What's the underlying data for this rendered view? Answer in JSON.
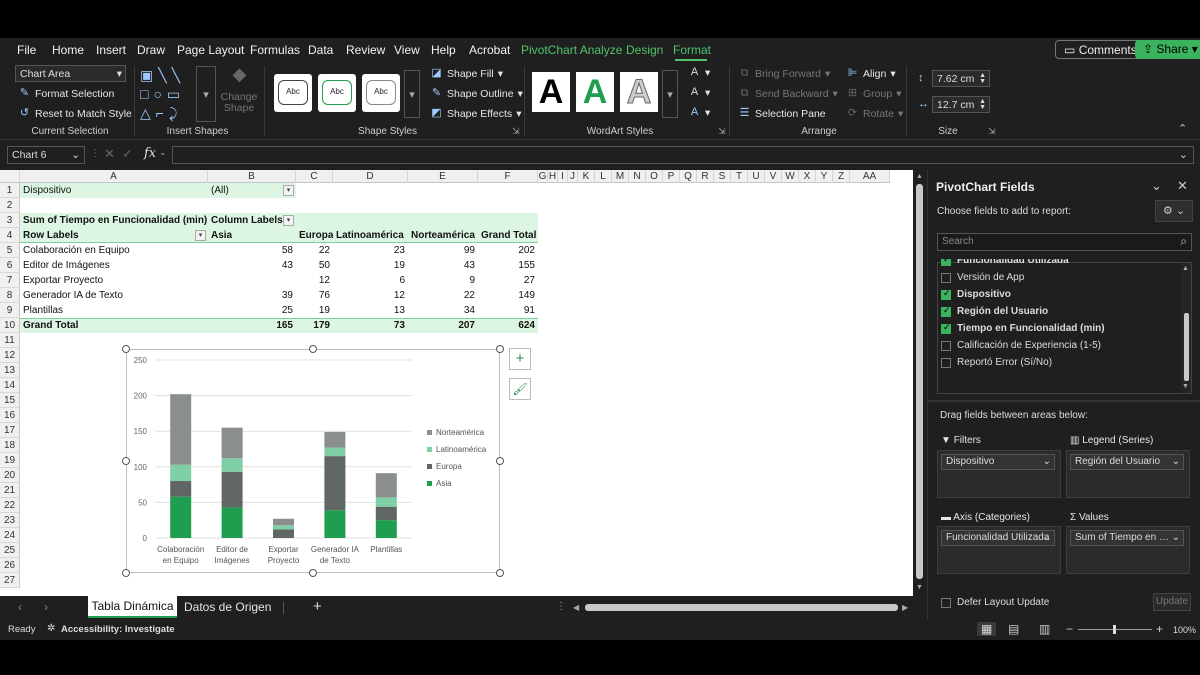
{
  "menu": {
    "tabs": [
      "File",
      "Home",
      "Insert",
      "Draw",
      "Page Layout",
      "Formulas",
      "Data",
      "Review",
      "View",
      "Help",
      "Acrobat",
      "PivotChart Analyze",
      "Design",
      "Format"
    ],
    "active_tab": "Format",
    "comments_label": "Comments",
    "share_label": "Share"
  },
  "ribbon": {
    "current_selection": {
      "dropdown_value": "Chart Area",
      "format_selection": "Format Selection",
      "reset": "Reset to Match Style",
      "label": "Current Selection"
    },
    "insert_shapes": {
      "change_shape": "Change Shape",
      "label": "Insert Shapes"
    },
    "shape_styles": {
      "sample": "Abc",
      "fill": "Shape Fill",
      "outline": "Shape Outline",
      "effects": "Shape Effects",
      "label": "Shape Styles"
    },
    "wordart": {
      "letter": "A",
      "label": "WordArt Styles"
    },
    "arrange": {
      "bring_forward": "Bring Forward",
      "send_backward": "Send Backward",
      "selection_pane": "Selection Pane",
      "align": "Align",
      "group": "Group",
      "rotate": "Rotate",
      "label": "Arrange"
    },
    "size": {
      "height": "7.62 cm",
      "width": "12.7 cm",
      "label": "Size"
    }
  },
  "formula_bar": {
    "name_box": "Chart 6",
    "fx": "fx"
  },
  "grid": {
    "columns": [
      "A",
      "B",
      "C",
      "D",
      "E",
      "F",
      "G",
      "H",
      "I",
      "J",
      "K",
      "L",
      "M",
      "N",
      "O",
      "P",
      "Q",
      "R",
      "S",
      "T",
      "U",
      "V",
      "W",
      "X",
      "Y",
      "Z",
      "AA"
    ],
    "rows": [
      "1",
      "2",
      "3",
      "4",
      "5",
      "6",
      "7",
      "8",
      "9",
      "10",
      "11",
      "12",
      "13",
      "14",
      "15",
      "16",
      "17",
      "18",
      "19",
      "20",
      "21",
      "22",
      "23",
      "24",
      "25",
      "26",
      "27"
    ],
    "filter_label": "Dispositivo",
    "filter_value": "(All)",
    "sum_label": "Sum of Tiempo en Funcionalidad (min)",
    "column_labels": "Column Labels",
    "row_labels": "Row Labels",
    "headers": [
      "Asia",
      "Europa",
      "Latinoamérica",
      "Norteamérica",
      "Grand Total"
    ],
    "data_rows": [
      {
        "label": "Colaboración en Equipo",
        "values": [
          "58",
          "22",
          "23",
          "99",
          "202"
        ]
      },
      {
        "label": "Editor de Imágenes",
        "values": [
          "43",
          "50",
          "19",
          "43",
          "155"
        ]
      },
      {
        "label": "Exportar Proyecto",
        "values": [
          "",
          "12",
          "6",
          "9",
          "27"
        ]
      },
      {
        "label": "Generador IA de Texto",
        "values": [
          "39",
          "76",
          "12",
          "22",
          "149"
        ]
      },
      {
        "label": "Plantillas",
        "values": [
          "25",
          "19",
          "13",
          "34",
          "91"
        ]
      }
    ],
    "grand_total": {
      "label": "Grand Total",
      "values": [
        "165",
        "179",
        "73",
        "207",
        "624"
      ]
    }
  },
  "chart_data": {
    "type": "bar",
    "stacked": true,
    "categories": [
      "Colaboración en Equipo",
      "Editor de Imágenes",
      "Exportar Proyecto",
      "Generador IA de Texto",
      "Plantillas"
    ],
    "category_labels": [
      [
        "Colaboración",
        "en Equipo"
      ],
      [
        "Editor de",
        "Imágenes"
      ],
      [
        "Exportar",
        "Proyecto"
      ],
      [
        "Generador IA",
        "de Texto"
      ],
      [
        "Plantillas"
      ]
    ],
    "series": [
      {
        "name": "Asia",
        "values": [
          58,
          43,
          0,
          39,
          25
        ],
        "color": "#1e9e4e"
      },
      {
        "name": "Europa",
        "values": [
          22,
          50,
          12,
          76,
          19
        ],
        "color": "#5f6664"
      },
      {
        "name": "Latinoamérica",
        "values": [
          23,
          19,
          6,
          12,
          13
        ],
        "color": "#7fcfa4"
      },
      {
        "name": "Norteamérica",
        "values": [
          99,
          43,
          9,
          22,
          34
        ],
        "color": "#8a8f8d"
      }
    ],
    "legend_order": [
      "Norteamérica",
      "Latinoamérica",
      "Europa",
      "Asia"
    ],
    "yticks": [
      "0",
      "50",
      "100",
      "150",
      "200",
      "250"
    ],
    "ylim": [
      0,
      250
    ],
    "legend": "right",
    "grid": true
  },
  "sheets": {
    "tabs": [
      "Tabla Dinámica",
      "Datos de Origen"
    ],
    "active": "Tabla Dinámica"
  },
  "status": {
    "ready": "Ready",
    "accessibility": "Accessibility: Investigate",
    "zoom": "100%"
  },
  "pane": {
    "title": "PivotChart Fields",
    "subtitle": "Choose fields to add to report:",
    "search_placeholder": "Search",
    "fields": [
      {
        "label": "Funcionalidad Utilizada",
        "checked": true
      },
      {
        "label": "Versión de App",
        "checked": false
      },
      {
        "label": "Dispositivo",
        "checked": true
      },
      {
        "label": "Región del Usuario",
        "checked": true
      },
      {
        "label": "Tiempo en Funcionalidad (min)",
        "checked": true
      },
      {
        "label": "Calificación de Experiencia (1-5)",
        "checked": false
      },
      {
        "label": "Reportó Error (Sí/No)",
        "checked": false
      }
    ],
    "drag_label": "Drag fields between areas below:",
    "areas": {
      "filters": {
        "title": "Filters",
        "item": "Dispositivo"
      },
      "legend": {
        "title": "Legend (Series)",
        "item": "Región del Usuario"
      },
      "axis": {
        "title": "Axis (Categories)",
        "item": "Funcionalidad Utilizada"
      },
      "values": {
        "title": "Values",
        "item": "Sum of Tiempo en Funcionalidad (min)"
      }
    },
    "defer_label": "Defer Layout Update",
    "update_label": "Update"
  }
}
